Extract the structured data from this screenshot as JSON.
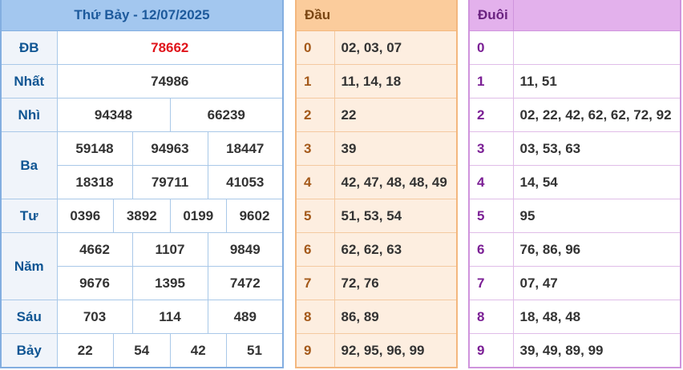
{
  "header": {
    "title": "Thứ Bảy - 12/07/2025"
  },
  "results": {
    "db": {
      "label": "ĐB",
      "values": [
        "78662"
      ]
    },
    "nhat": {
      "label": "Nhất",
      "values": [
        "74986"
      ]
    },
    "nhi": {
      "label": "Nhì",
      "values": [
        "94348",
        "66239"
      ]
    },
    "ba": {
      "label": "Ba",
      "values": [
        "59148",
        "94963",
        "18447",
        "18318",
        "79711",
        "41053"
      ]
    },
    "tu": {
      "label": "Tư",
      "values": [
        "0396",
        "3892",
        "0199",
        "9602"
      ]
    },
    "nam": {
      "label": "Năm",
      "values": [
        "4662",
        "1107",
        "9849",
        "9676",
        "1395",
        "7472"
      ]
    },
    "sau": {
      "label": "Sáu",
      "values": [
        "703",
        "114",
        "489"
      ]
    },
    "bay": {
      "label": "Bảy",
      "values": [
        "22",
        "54",
        "42",
        "51"
      ]
    }
  },
  "dau": {
    "title": "Đầu",
    "rows": [
      {
        "digit": "0",
        "values": "02, 03, 07"
      },
      {
        "digit": "1",
        "values": "11, 14, 18"
      },
      {
        "digit": "2",
        "values": "22"
      },
      {
        "digit": "3",
        "values": "39"
      },
      {
        "digit": "4",
        "values": "42, 47, 48, 48, 49"
      },
      {
        "digit": "5",
        "values": "51, 53, 54"
      },
      {
        "digit": "6",
        "values": "62, 62, 63"
      },
      {
        "digit": "7",
        "values": "72, 76"
      },
      {
        "digit": "8",
        "values": "86, 89"
      },
      {
        "digit": "9",
        "values": "92, 95, 96, 99"
      }
    ]
  },
  "duoi": {
    "title": "Đuôi",
    "rows": [
      {
        "digit": "0",
        "values": ""
      },
      {
        "digit": "1",
        "values": "11, 51"
      },
      {
        "digit": "2",
        "values": "02, 22, 42, 62, 62, 72, 92"
      },
      {
        "digit": "3",
        "values": "03, 53, 63"
      },
      {
        "digit": "4",
        "values": "14, 54"
      },
      {
        "digit": "5",
        "values": "95"
      },
      {
        "digit": "6",
        "values": "76, 86, 96"
      },
      {
        "digit": "7",
        "values": "07, 47"
      },
      {
        "digit": "8",
        "values": "18, 48, 48"
      },
      {
        "digit": "9",
        "values": "39, 49, 89, 99"
      }
    ]
  }
}
